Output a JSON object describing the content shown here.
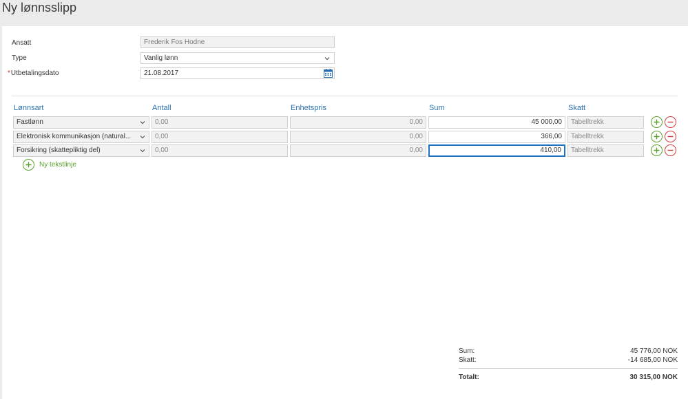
{
  "page": {
    "title": "Ny lønnsslipp"
  },
  "form": {
    "employee_label": "Ansatt",
    "employee_value": "Frederik Fos Hodne",
    "type_label": "Type",
    "type_value": "Vanlig lønn",
    "date_required_mark": "*",
    "date_label": "Utbetalingsdato",
    "date_value": "21.08.2017"
  },
  "table": {
    "headers": [
      "Lønnsart",
      "Antall",
      "Enhetspris",
      "Sum",
      "Skatt"
    ],
    "rows": [
      {
        "type": "Fastlønn",
        "antall": "0,00",
        "enhetspris": "0,00",
        "sum": "45 000,00",
        "skatt": "Tabelltrekk"
      },
      {
        "type": "Elektronisk kommunikasjon (natural...",
        "antall": "0,00",
        "enhetspris": "0,00",
        "sum": "366,00",
        "skatt": "Tabelltrekk"
      },
      {
        "type": "Forsikring (skattepliktig del)",
        "antall": "0,00",
        "enhetspris": "0,00",
        "sum": "410,00",
        "skatt": "Tabelltrekk"
      }
    ],
    "add_line_label": "Ny tekstlinje"
  },
  "totals": {
    "sum_label": "Sum:",
    "sum_value": "45 776,00 NOK",
    "skatt_label": "Skatt:",
    "skatt_value": "-14 685,00 NOK",
    "total_label": "Totalt:",
    "total_value": "30 315,00 NOK"
  },
  "colors": {
    "accent_blue": "#2a6fb0",
    "add_green": "#5aa02c",
    "remove_red": "#d23a3a",
    "required_red": "#d0312d"
  },
  "icons": {
    "dropdown": "chevron-down-icon",
    "calendar": "calendar-icon",
    "add": "plus-circle-icon",
    "remove": "minus-circle-icon"
  }
}
